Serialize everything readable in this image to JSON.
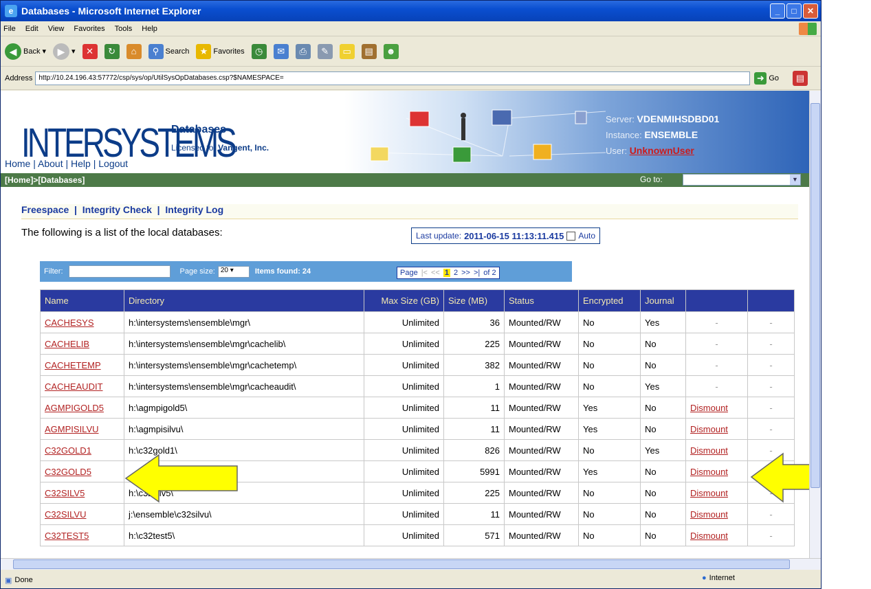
{
  "window": {
    "title": "Databases - Microsoft Internet Explorer"
  },
  "menu": [
    "File",
    "Edit",
    "View",
    "Favorites",
    "Tools",
    "Help"
  ],
  "toolbar": {
    "back": "Back",
    "search": "Search",
    "favorites": "Favorites"
  },
  "address": {
    "label": "Address",
    "url": "http://10.24.196.43:57772/csp/sys/op/UtilSysOpDatabases.csp?$NAMESPACE=",
    "go": "Go"
  },
  "banner": {
    "logo": "INTERSYSTEMS",
    "page_title": "Databases",
    "licensed_label": "Licensed to:",
    "licensed_to": "Vangent, Inc.",
    "nav": {
      "home": "Home",
      "about": "About",
      "help": "Help",
      "logout": "Logout"
    },
    "server_label": "Server:",
    "server": "VDENMIHSDBD01",
    "instance_label": "Instance:",
    "instance": "ENSEMBLE",
    "user_label": "User:",
    "user": "UnknownUser"
  },
  "breadcrumb": {
    "home": "[Home]",
    "sep": " > ",
    "current": "[Databases]",
    "goto": "Go to:"
  },
  "links": {
    "freespace": "Freespace",
    "integrity_check": "Integrity Check",
    "integrity_log": "Integrity Log"
  },
  "intro": "The following is a list of the local databases:",
  "last_update": {
    "label": "Last update:",
    "value": "2011-06-15 11:13:11.415",
    "auto": "Auto"
  },
  "filter": {
    "label": "Filter:",
    "page_size_label": "Page size:",
    "page_size": "20",
    "items_found": "Items found: 24"
  },
  "pager": {
    "label": "Page",
    "first": "|<",
    "prev": "<<",
    "current": "1",
    "next_page": "2",
    "next": ">>",
    "last": ">|",
    "of": "of 2"
  },
  "table": {
    "headers": [
      "Name",
      "Directory",
      "Max Size (GB)",
      "Size (MB)",
      "Status",
      "Encrypted",
      "Journal",
      "",
      ""
    ],
    "rows": [
      {
        "name": "CACHESYS",
        "dir": "h:\\intersystems\\ensemble\\mgr\\",
        "max": "Unlimited",
        "size": "36",
        "status": "Mounted/RW",
        "enc": "No",
        "journal": "Yes",
        "action": "-",
        "extra": "-"
      },
      {
        "name": "CACHELIB",
        "dir": "h:\\intersystems\\ensemble\\mgr\\cachelib\\",
        "max": "Unlimited",
        "size": "225",
        "status": "Mounted/RW",
        "enc": "No",
        "journal": "No",
        "action": "-",
        "extra": "-"
      },
      {
        "name": "CACHETEMP",
        "dir": "h:\\intersystems\\ensemble\\mgr\\cachetemp\\",
        "max": "Unlimited",
        "size": "382",
        "status": "Mounted/RW",
        "enc": "No",
        "journal": "No",
        "action": "-",
        "extra": "-"
      },
      {
        "name": "CACHEAUDIT",
        "dir": "h:\\intersystems\\ensemble\\mgr\\cacheaudit\\",
        "max": "Unlimited",
        "size": "1",
        "status": "Mounted/RW",
        "enc": "No",
        "journal": "Yes",
        "action": "-",
        "extra": "-"
      },
      {
        "name": "AGMPIGOLD5",
        "dir": "h:\\agmpigold5\\",
        "max": "Unlimited",
        "size": "11",
        "status": "Mounted/RW",
        "enc": "Yes",
        "journal": "No",
        "action": "Dismount",
        "extra": "-"
      },
      {
        "name": "AGMPISILVU",
        "dir": "h:\\agmpisilvu\\",
        "max": "Unlimited",
        "size": "11",
        "status": "Mounted/RW",
        "enc": "Yes",
        "journal": "No",
        "action": "Dismount",
        "extra": "-"
      },
      {
        "name": "C32GOLD1",
        "dir": "h:\\c32gold1\\",
        "max": "Unlimited",
        "size": "826",
        "status": "Mounted/RW",
        "enc": "No",
        "journal": "Yes",
        "action": "Dismount",
        "extra": "-"
      },
      {
        "name": "C32GOLD5",
        "dir": "",
        "max": "Unlimited",
        "size": "5991",
        "status": "Mounted/RW",
        "enc": "Yes",
        "journal": "No",
        "action": "Dismount",
        "extra": ""
      },
      {
        "name": "C32SILV5",
        "dir": "h:\\c32silv5\\",
        "max": "Unlimited",
        "size": "225",
        "status": "Mounted/RW",
        "enc": "No",
        "journal": "No",
        "action": "Dismount",
        "extra": "-"
      },
      {
        "name": "C32SILVU",
        "dir": "j:\\ensemble\\c32silvu\\",
        "max": "Unlimited",
        "size": "11",
        "status": "Mounted/RW",
        "enc": "No",
        "journal": "No",
        "action": "Dismount",
        "extra": "-"
      },
      {
        "name": "C32TEST5",
        "dir": "h:\\c32test5\\",
        "max": "Unlimited",
        "size": "571",
        "status": "Mounted/RW",
        "enc": "No",
        "journal": "No",
        "action": "Dismount",
        "extra": "-"
      }
    ]
  },
  "status": {
    "text": "Done",
    "zone": "Internet"
  },
  "colors": {
    "title_bar": "#0a4fd0",
    "header_bg": "#2a3aa0",
    "link_red": "#b22222",
    "arrow_yellow": "#ffff00",
    "crumb_green": "#4d7a48"
  }
}
